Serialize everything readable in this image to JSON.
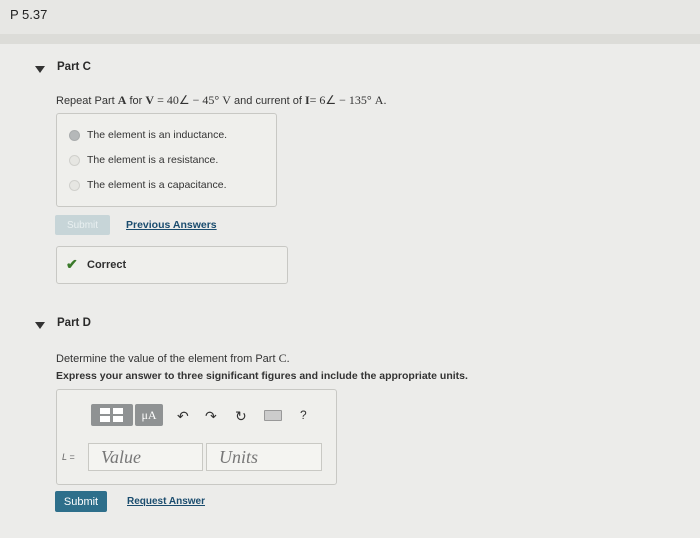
{
  "problem_title": "P 5.37",
  "part_c": {
    "label": "Part C",
    "question": {
      "pre": "Repeat Part",
      "part_ref": "A",
      "for": "for",
      "v_symbol": "V",
      "v_value": "= 40∠ − 45°",
      "v_unit": "V",
      "and_current": "and current of",
      "i_symbol": "I",
      "i_value": "= 6∠ − 135°",
      "i_unit": "A."
    },
    "choices": [
      {
        "label": "The element is an inductance.",
        "selected": true
      },
      {
        "label": "The element is a resistance.",
        "selected": false
      },
      {
        "label": "The element is a capacitance.",
        "selected": false
      }
    ],
    "submit_label": "Submit",
    "previous_answers_label": "Previous Answers",
    "feedback": "Correct"
  },
  "part_d": {
    "label": "Part D",
    "prompt_pre": "Determine the value of the element from Part",
    "prompt_ref": "C.",
    "instruction": "Express your answer to three significant figures and include the appropriate units.",
    "toolbar": {
      "template_icon": "matrix-template-icon",
      "units_button": "μA",
      "undo_icon": "undo-icon",
      "redo_icon": "redo-icon",
      "reset_icon": "reset-icon",
      "keyboard_icon": "keyboard-icon",
      "help_label": "?"
    },
    "variable_label": "L =",
    "value_placeholder": "Value",
    "units_placeholder": "Units",
    "submit_label": "Submit",
    "request_answer_label": "Request Answer"
  },
  "colors": {
    "accent_blue": "#2e6f8b",
    "link_blue": "#1a4c6e",
    "success_green": "#3b7a2b",
    "panel_bg": "#ececea"
  }
}
